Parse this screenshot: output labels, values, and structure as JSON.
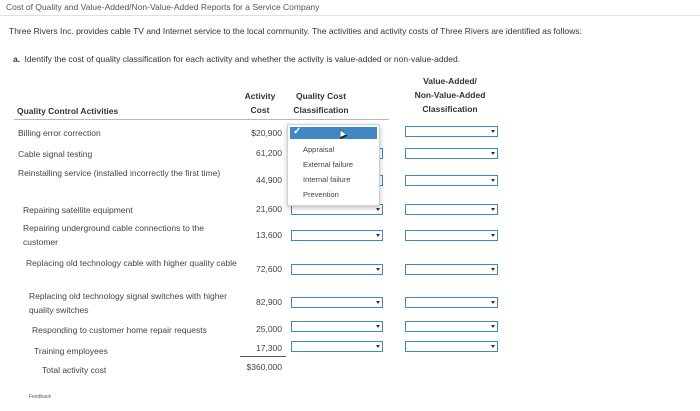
{
  "page_title": "Cost of Quality and Value-Added/Non-Value-Added Reports for a Service Company",
  "intro": "Three Rivers Inc. provides cable TV and Internet service to the local community. The activities and activity costs of Three Rivers are identified as follows:",
  "part_a": {
    "letter": "a.",
    "text": "Identify the cost of quality classification for each activity and whether the activity is value-added or non-value-added."
  },
  "headers": {
    "activities": "Quality Control Activities",
    "cost_line1": "Activity",
    "cost_line2": "Cost",
    "quality_line1": "Quality Cost",
    "quality_line2": "Classification",
    "vna_line1": "Value-Added/",
    "vna_line2": "Non-Value-Added",
    "vna_line3": "Classification"
  },
  "rows": [
    {
      "activity": "Billing error correction",
      "cost": "$20,900"
    },
    {
      "activity": "Cable signal testing",
      "cost": "61,200"
    },
    {
      "activity": "Reinstalling service (installed incorrectly the first time)",
      "cost": "44,900"
    },
    {
      "activity": "Repairing satellite equipment",
      "cost": "21,600"
    },
    {
      "activity": "Repairing underground cable connections to the customer",
      "cost": "13,600"
    },
    {
      "activity": "Replacing old technology cable with higher quality cable",
      "cost": "72,600"
    },
    {
      "activity": "Replacing old technology signal switches with higher quality switches",
      "cost": "82,900"
    },
    {
      "activity": "Responding to customer home repair requests",
      "cost": "25,000"
    },
    {
      "activity": "Training employees",
      "cost": "17,300"
    }
  ],
  "total": {
    "label": "Total activity cost",
    "cost": "$360,000"
  },
  "dropdown_options": [
    "Appraisal",
    "External failure",
    "Internal failure",
    "Prevention"
  ],
  "feedback_label": "Feedback",
  "accent_color": "#3f88c5"
}
